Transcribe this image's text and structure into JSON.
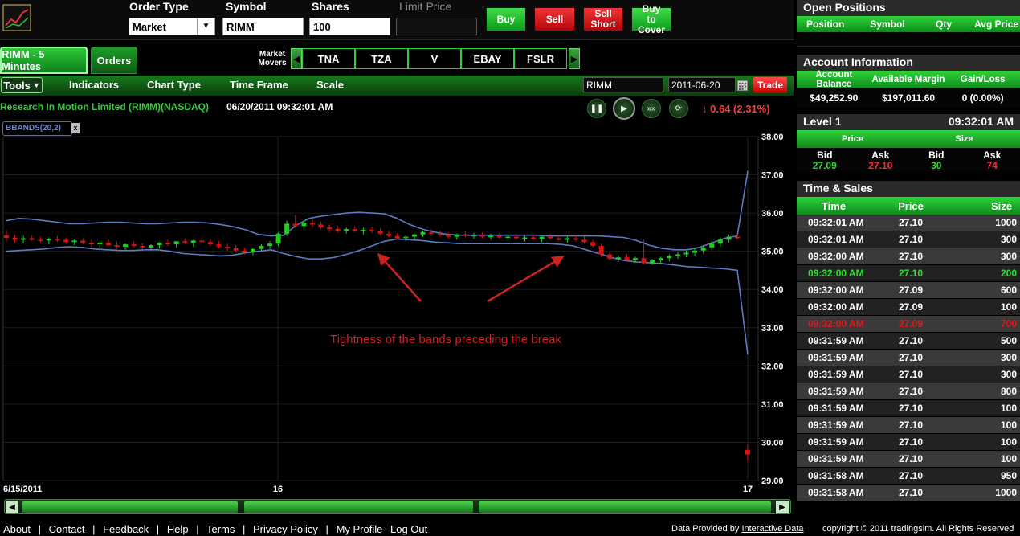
{
  "order_bar": {
    "order_type_label": "Order Type",
    "order_type_value": "Market",
    "symbol_label": "Symbol",
    "symbol_value": "RIMM",
    "shares_label": "Shares",
    "shares_value": "100",
    "limit_price_label": "Limit Price",
    "limit_price_value": "",
    "buy_label": "Buy",
    "sell_label": "Sell",
    "sell_short_label": "Sell Short",
    "buy_to_cover_label": "Buy to Cover",
    "colors": {
      "buy": "#1fbf2c",
      "sell": "#e0181d"
    }
  },
  "tabs": [
    {
      "label": "RIMM - 5 Minutes",
      "active": true
    },
    {
      "label": "Orders",
      "active": false
    }
  ],
  "market_movers": {
    "label": "Market Movers",
    "symbols": [
      "TNA",
      "TZA",
      "V",
      "EBAY",
      "FSLR"
    ]
  },
  "chart_toolbar": {
    "tools_label": "Tools",
    "items": [
      "Indicators",
      "Chart Type",
      "Time Frame",
      "Scale"
    ],
    "symbol_input": "RIMM",
    "date_input": "2011-06-20",
    "trade_label": "Trade"
  },
  "chart_header": {
    "company": "Research In Motion Limited (RIMM)(NASDAQ)",
    "timestamp": "06/20/2011 09:32:01 AM",
    "change": "0.64 (2.31%)",
    "indicator_tag": "BBANDS(20,2)",
    "indicator_close": "x"
  },
  "chart_data": {
    "type": "candlestick",
    "y_ticks": [
      "38.00",
      "37.00",
      "36.00",
      "35.00",
      "34.00",
      "33.00",
      "32.00",
      "31.00",
      "30.00",
      "29.00"
    ],
    "ylim": [
      29,
      38
    ],
    "x_ticks": [
      "6/15/2011",
      "16",
      "17"
    ],
    "annotation": "Tightness of the bands preceding the break",
    "grid": true,
    "colors": {
      "up": "#20d020",
      "down": "#e01010",
      "band": "#5a7cc0",
      "annotation": "#cc2222"
    },
    "candles": [
      [
        35.42,
        35.55,
        35.25,
        35.35
      ],
      [
        35.35,
        35.42,
        35.22,
        35.3
      ],
      [
        35.3,
        35.4,
        35.2,
        35.34
      ],
      [
        35.34,
        35.42,
        35.26,
        35.3
      ],
      [
        35.3,
        35.38,
        35.22,
        35.28
      ],
      [
        35.28,
        35.36,
        35.18,
        35.32
      ],
      [
        35.32,
        35.4,
        35.24,
        35.3
      ],
      [
        35.3,
        35.36,
        35.2,
        35.24
      ],
      [
        35.24,
        35.32,
        35.16,
        35.28
      ],
      [
        35.28,
        35.34,
        35.18,
        35.22
      ],
      [
        35.22,
        35.3,
        35.12,
        35.18
      ],
      [
        35.18,
        35.26,
        35.1,
        35.22
      ],
      [
        35.22,
        35.3,
        35.14,
        35.16
      ],
      [
        35.16,
        35.24,
        35.06,
        35.12
      ],
      [
        35.12,
        35.2,
        35.04,
        35.18
      ],
      [
        35.18,
        35.26,
        35.1,
        35.14
      ],
      [
        35.14,
        35.22,
        35.06,
        35.1
      ],
      [
        35.1,
        35.18,
        35.02,
        35.16
      ],
      [
        35.16,
        35.24,
        35.08,
        35.22
      ],
      [
        35.22,
        35.3,
        35.14,
        35.18
      ],
      [
        35.18,
        35.26,
        35.1,
        35.26
      ],
      [
        35.26,
        35.34,
        35.18,
        35.22
      ],
      [
        35.22,
        35.3,
        35.12,
        35.28
      ],
      [
        35.28,
        35.36,
        35.2,
        35.24
      ],
      [
        35.24,
        35.32,
        35.14,
        35.18
      ],
      [
        35.18,
        35.26,
        35.08,
        35.12
      ],
      [
        35.12,
        35.2,
        35.02,
        35.08
      ],
      [
        35.08,
        35.16,
        34.96,
        35.02
      ],
      [
        35.02,
        35.1,
        34.92,
        34.98
      ],
      [
        34.98,
        35.08,
        34.9,
        35.06
      ],
      [
        35.06,
        35.18,
        35.0,
        35.14
      ],
      [
        35.14,
        35.26,
        35.06,
        35.2
      ],
      [
        35.2,
        35.5,
        35.14,
        35.46
      ],
      [
        35.46,
        35.8,
        35.4,
        35.72
      ],
      [
        35.72,
        35.95,
        35.6,
        35.66
      ],
      [
        35.66,
        35.8,
        35.56,
        35.74
      ],
      [
        35.74,
        35.84,
        35.62,
        35.7
      ],
      [
        35.7,
        35.78,
        35.58,
        35.62
      ],
      [
        35.62,
        35.7,
        35.5,
        35.58
      ],
      [
        35.58,
        35.66,
        35.48,
        35.54
      ],
      [
        35.54,
        35.62,
        35.46,
        35.58
      ],
      [
        35.58,
        35.66,
        35.5,
        35.54
      ],
      [
        35.54,
        35.62,
        35.44,
        35.56
      ],
      [
        35.56,
        35.64,
        35.48,
        35.52
      ],
      [
        35.52,
        35.6,
        35.42,
        35.46
      ],
      [
        35.46,
        35.54,
        35.36,
        35.4
      ],
      [
        35.4,
        35.48,
        35.3,
        35.34
      ],
      [
        35.34,
        35.42,
        35.26,
        35.38
      ],
      [
        35.38,
        35.46,
        35.3,
        35.44
      ],
      [
        35.44,
        35.54,
        35.38,
        35.5
      ],
      [
        35.5,
        35.58,
        35.42,
        35.46
      ],
      [
        35.46,
        35.54,
        35.38,
        35.42
      ],
      [
        35.42,
        35.5,
        35.34,
        35.38
      ],
      [
        35.38,
        35.46,
        35.3,
        35.44
      ],
      [
        35.44,
        35.52,
        35.36,
        35.4
      ],
      [
        35.4,
        35.48,
        35.32,
        35.42
      ],
      [
        35.42,
        35.5,
        35.34,
        35.38
      ],
      [
        35.38,
        35.46,
        35.3,
        35.4
      ],
      [
        35.4,
        35.48,
        35.32,
        35.36
      ],
      [
        35.36,
        35.44,
        35.28,
        35.38
      ],
      [
        35.38,
        35.46,
        35.3,
        35.34
      ],
      [
        35.34,
        35.42,
        35.26,
        35.36
      ],
      [
        35.36,
        35.44,
        35.28,
        35.32
      ],
      [
        35.32,
        35.4,
        35.24,
        35.38
      ],
      [
        35.38,
        35.46,
        35.3,
        35.34
      ],
      [
        35.34,
        35.42,
        35.26,
        35.3
      ],
      [
        35.3,
        35.38,
        35.22,
        35.34
      ],
      [
        35.34,
        35.42,
        35.26,
        35.3
      ],
      [
        35.3,
        35.38,
        35.2,
        35.24
      ],
      [
        35.24,
        35.3,
        35.1,
        35.14
      ],
      [
        35.14,
        35.2,
        34.86,
        34.92
      ],
      [
        34.92,
        35.0,
        34.76,
        34.8
      ],
      [
        34.8,
        34.9,
        34.72,
        34.84
      ],
      [
        34.84,
        34.92,
        34.74,
        34.78
      ],
      [
        34.78,
        34.86,
        34.7,
        34.82
      ],
      [
        34.82,
        35.3,
        34.66,
        34.7
      ],
      [
        34.7,
        34.8,
        34.64,
        34.76
      ],
      [
        34.76,
        34.86,
        34.68,
        34.82
      ],
      [
        34.82,
        34.92,
        34.74,
        34.88
      ],
      [
        34.88,
        34.98,
        34.8,
        34.92
      ],
      [
        34.92,
        35.02,
        34.84,
        34.96
      ],
      [
        34.96,
        35.1,
        34.88,
        35.02
      ],
      [
        35.02,
        35.16,
        34.94,
        35.1
      ],
      [
        35.1,
        35.26,
        35.02,
        35.2
      ],
      [
        35.2,
        35.36,
        35.12,
        35.3
      ],
      [
        35.3,
        35.44,
        35.22,
        35.38
      ],
      [
        35.38,
        35.46,
        35.3,
        35.34
      ],
      [
        29.8,
        29.95,
        29.5,
        29.68
      ]
    ],
    "upper_band": [
      35.8,
      35.86,
      35.84,
      35.8,
      35.76,
      35.72,
      35.72,
      35.74,
      35.76,
      35.76,
      35.74,
      35.72,
      35.72,
      35.74,
      35.76,
      35.76,
      35.74,
      35.7,
      35.64,
      35.56,
      35.44,
      35.4,
      35.42,
      35.68,
      35.86,
      35.92,
      35.96,
      36.0,
      36.02,
      36.0,
      35.98,
      35.86,
      35.7,
      35.58,
      35.5,
      35.44,
      35.42,
      35.42,
      35.42,
      35.42,
      35.42,
      35.42,
      35.42,
      35.4,
      35.4,
      35.4,
      35.4,
      35.4,
      35.38,
      35.36,
      35.28,
      35.16,
      35.08,
      35.04,
      35.04,
      35.1,
      35.22,
      35.34,
      35.4,
      37.1
    ],
    "lower_band": [
      35.0,
      35.02,
      35.04,
      35.06,
      35.1,
      35.12,
      35.1,
      35.06,
      35.04,
      35.02,
      35.02,
      35.04,
      35.04,
      35.0,
      34.94,
      34.92,
      34.9,
      34.88,
      34.9,
      34.96,
      35.0,
      35.04,
      34.94,
      34.86,
      34.8,
      34.8,
      34.84,
      34.92,
      35.02,
      35.14,
      35.26,
      35.32,
      35.3,
      35.28,
      35.24,
      35.22,
      35.2,
      35.2,
      35.2,
      35.2,
      35.2,
      35.2,
      35.2,
      35.2,
      35.18,
      35.14,
      35.04,
      34.94,
      34.84,
      34.76,
      34.72,
      34.7,
      34.68,
      34.64,
      34.6,
      34.58,
      34.56,
      34.54,
      34.5,
      32.3
    ]
  },
  "scrollbar": {
    "left_arrow": "◀",
    "right_arrow": "▶"
  },
  "footer": {
    "links": [
      "About",
      "Contact",
      "Feedback",
      "Help",
      "Terms",
      "Privacy Policy",
      "My Profile",
      "Log Out"
    ],
    "separator": "|",
    "data_provided_prefix": "Data Provided by",
    "data_provider": "Interactive Data",
    "copyright": "copyright © 2011 tradingsim. All Rights Reserved"
  },
  "open_positions": {
    "title": "Open Positions",
    "columns": [
      "Position",
      "Symbol",
      "Qty",
      "Avg Price"
    ]
  },
  "account_info": {
    "title": "Account Information",
    "columns": [
      "Account Balance",
      "Available Margin",
      "Gain/Loss"
    ],
    "values": [
      "$49,252.90",
      "$197,011.60",
      "0 (0.00%)"
    ]
  },
  "level1": {
    "title": "Level 1",
    "time": "09:32:01 AM",
    "price_label": "Price",
    "size_label": "Size",
    "bid_label": "Bid",
    "ask_label": "Ask",
    "bid_price": "27.09",
    "ask_price": "27.10",
    "bid_size": "30",
    "ask_size": "74",
    "colors": {
      "bid": "#2fd82f",
      "ask": "#ff2a2a"
    }
  },
  "time_sales": {
    "title": "Time & Sales",
    "columns": [
      "Time",
      "Price",
      "Size"
    ],
    "rows": [
      {
        "time": "09:32:01 AM",
        "price": "27.10",
        "size": "1000",
        "color": "#ffffff"
      },
      {
        "time": "09:32:01 AM",
        "price": "27.10",
        "size": "300",
        "color": "#ffffff"
      },
      {
        "time": "09:32:00 AM",
        "price": "27.10",
        "size": "300",
        "color": "#ffffff"
      },
      {
        "time": "09:32:00 AM",
        "price": "27.10",
        "size": "200",
        "color": "#2fe02f"
      },
      {
        "time": "09:32:00 AM",
        "price": "27.09",
        "size": "600",
        "color": "#ffffff"
      },
      {
        "time": "09:32:00 AM",
        "price": "27.09",
        "size": "100",
        "color": "#ffffff"
      },
      {
        "time": "09:32:00 AM",
        "price": "27.09",
        "size": "700",
        "color": "#e01818"
      },
      {
        "time": "09:31:59 AM",
        "price": "27.10",
        "size": "500",
        "color": "#ffffff"
      },
      {
        "time": "09:31:59 AM",
        "price": "27.10",
        "size": "300",
        "color": "#ffffff"
      },
      {
        "time": "09:31:59 AM",
        "price": "27.10",
        "size": "300",
        "color": "#ffffff"
      },
      {
        "time": "09:31:59 AM",
        "price": "27.10",
        "size": "800",
        "color": "#ffffff"
      },
      {
        "time": "09:31:59 AM",
        "price": "27.10",
        "size": "100",
        "color": "#ffffff"
      },
      {
        "time": "09:31:59 AM",
        "price": "27.10",
        "size": "100",
        "color": "#ffffff"
      },
      {
        "time": "09:31:59 AM",
        "price": "27.10",
        "size": "100",
        "color": "#ffffff"
      },
      {
        "time": "09:31:59 AM",
        "price": "27.10",
        "size": "100",
        "color": "#ffffff"
      },
      {
        "time": "09:31:58 AM",
        "price": "27.10",
        "size": "950",
        "color": "#ffffff"
      },
      {
        "time": "09:31:58 AM",
        "price": "27.10",
        "size": "1000",
        "color": "#ffffff"
      }
    ]
  }
}
